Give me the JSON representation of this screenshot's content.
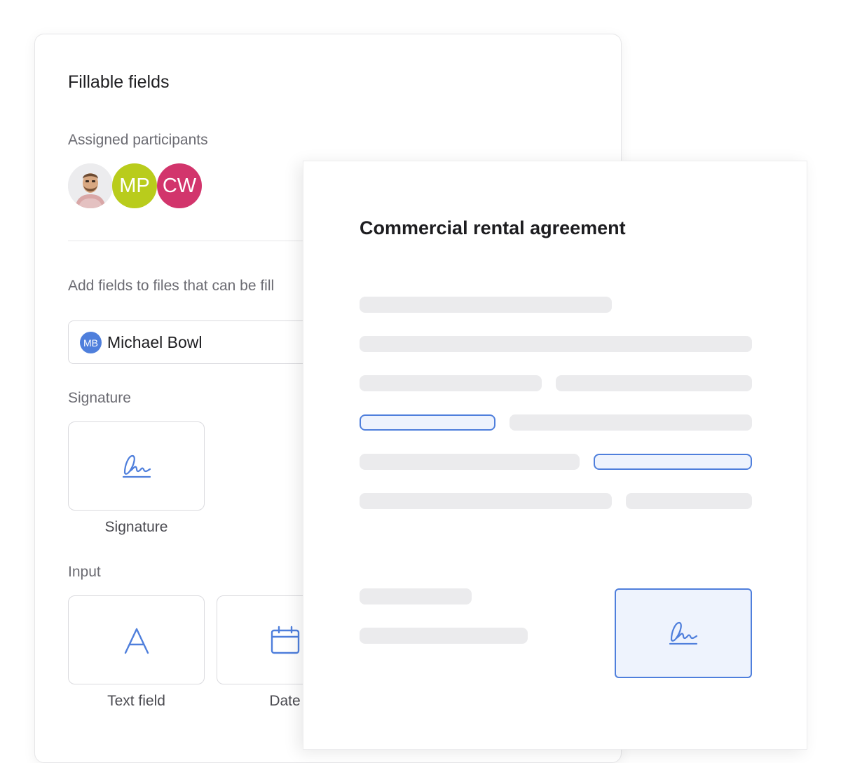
{
  "panel": {
    "title": "Fillable fields",
    "assigned_label": "Assigned participants",
    "participants": [
      {
        "kind": "photo",
        "name": "participant-photo"
      },
      {
        "initials": "MP",
        "color": "#b9cc1c"
      },
      {
        "initials": "CW",
        "color": "#d2356c"
      }
    ],
    "add_fields_text": "Add fields to files that can be fill",
    "selected_participant": {
      "initials": "MB",
      "name": "Michael Bowl",
      "color": "#4f7fdc"
    },
    "signature_section": "Signature",
    "signature_tile": {
      "label": "Signature",
      "icon": "signature-icon"
    },
    "input_section": "Input",
    "input_tiles": [
      {
        "label": "Text field",
        "icon": "text-field-icon"
      },
      {
        "label": "Date",
        "icon": "calendar-icon"
      }
    ]
  },
  "document": {
    "title": "Commercial rental agreement",
    "signature_icon": "signature-icon"
  },
  "colors": {
    "accent": "#4f7fdc",
    "placeholder_line": "#ebebed",
    "field_fill": "#eef3fd"
  }
}
